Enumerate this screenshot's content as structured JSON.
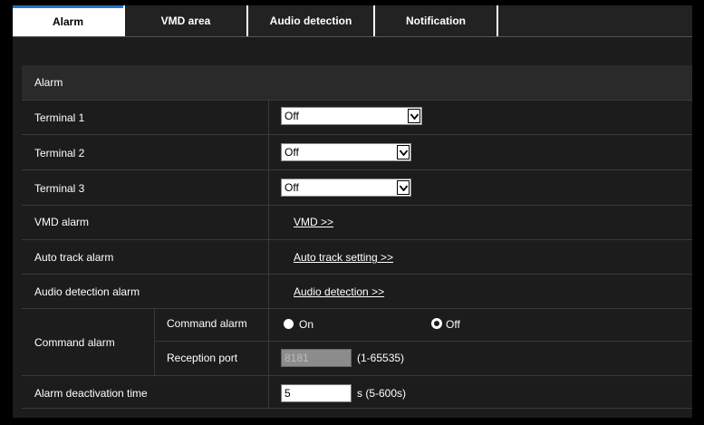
{
  "tabs": [
    "Alarm",
    "VMD area",
    "Audio detection",
    "Notification"
  ],
  "section_title": "Alarm",
  "terminals": [
    {
      "label": "Terminal 1",
      "value": "Off"
    },
    {
      "label": "Terminal 2",
      "value": "Off"
    },
    {
      "label": "Terminal 3",
      "value": "Off"
    }
  ],
  "vmd_alarm": {
    "label": "VMD alarm",
    "link": "VMD >>"
  },
  "auto_track": {
    "label": "Auto track alarm",
    "link": "Auto track setting >>"
  },
  "audio_alarm": {
    "label": "Audio detection alarm",
    "link": "Audio detection >>"
  },
  "command_alarm": {
    "group_label": "Command alarm",
    "sub_label": "Command alarm",
    "on_label": "On",
    "off_label": "Off",
    "selected": "Off",
    "port_label": "Reception port",
    "port_value": "8181",
    "port_range": "(1-65535)"
  },
  "deactivation": {
    "label": "Alarm deactivation time",
    "value": "5",
    "unit": "s (5-600s)"
  }
}
